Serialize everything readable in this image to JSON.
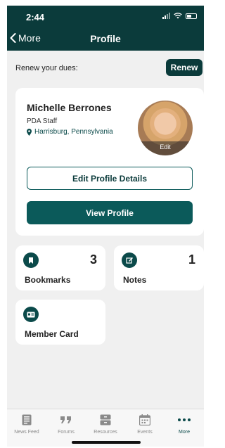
{
  "status_bar": {
    "time": "2:44"
  },
  "header": {
    "back_label": "More",
    "title": "Profile"
  },
  "renew": {
    "label": "Renew your dues:",
    "button": "Renew"
  },
  "profile": {
    "name": "Michelle Berrones",
    "role": "PDA Staff",
    "location": "Harrisburg, Pennsylvania",
    "avatar_edit": "Edit",
    "edit_button": "Edit Profile Details",
    "view_button": "View Profile"
  },
  "tiles": [
    {
      "label": "Bookmarks",
      "count": "3",
      "icon": "bookmark-icon"
    },
    {
      "label": "Notes",
      "count": "1",
      "icon": "note-edit-icon"
    },
    {
      "label": "Member Card",
      "icon": "id-card-icon"
    }
  ],
  "tabbar": {
    "items": [
      {
        "label": "News Feed",
        "icon": "news-feed-icon"
      },
      {
        "label": "Forums",
        "icon": "quote-icon"
      },
      {
        "label": "Resources",
        "icon": "archive-icon"
      },
      {
        "label": "Events",
        "icon": "calendar-icon"
      },
      {
        "label": "More",
        "icon": "more-dots-icon",
        "active": true
      }
    ]
  },
  "colors": {
    "brand": "#0b3b3b",
    "accent": "#0b5a5a",
    "background": "#f0f0f0"
  }
}
